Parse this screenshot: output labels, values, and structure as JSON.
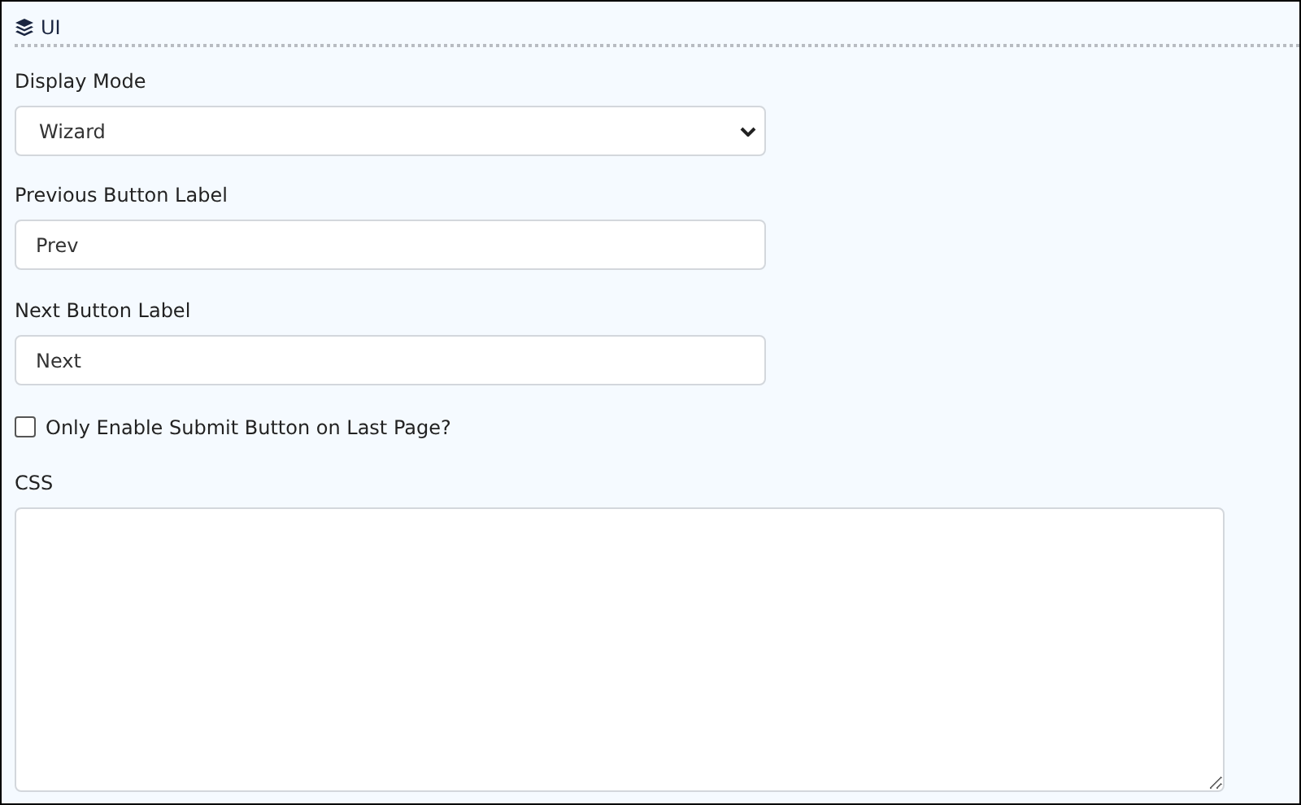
{
  "section": {
    "title": "UI"
  },
  "fields": [
    {
      "kind": "select",
      "label": "Display Mode",
      "value": "Wizard"
    },
    {
      "kind": "text",
      "label": "Previous Button Label",
      "value": "Prev"
    },
    {
      "kind": "text",
      "label": "Next Button Label",
      "value": "Next"
    },
    {
      "kind": "checkbox",
      "label": "Only Enable Submit Button on Last Page?",
      "checked": false
    },
    {
      "kind": "textarea",
      "label": "CSS"
    }
  ]
}
